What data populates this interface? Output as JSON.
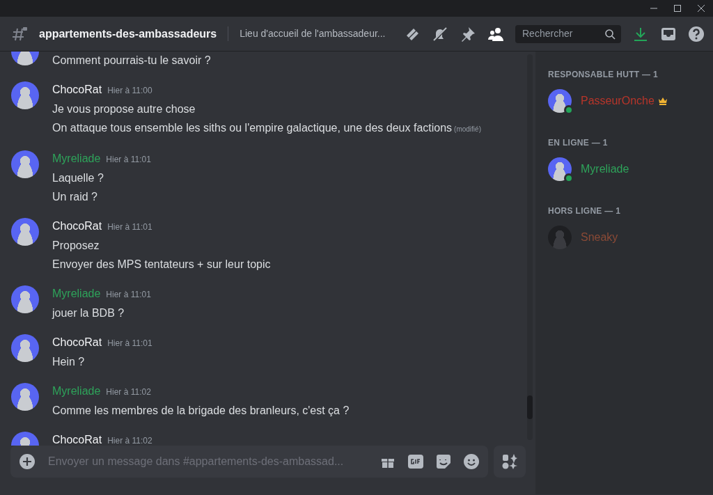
{
  "channel": {
    "name": "appartements-des-ambassadeurs",
    "topic": "Lieu d'accueil de l'ambassadeur..."
  },
  "search": {
    "placeholder": "Rechercher"
  },
  "messages": [
    {
      "lines": [
        {
          "text": "Comment pourrais-tu le savoir ?"
        }
      ]
    },
    {
      "author": "ChocoRat",
      "color": "#f2f3f5",
      "time": "Hier à 11:00",
      "lines": [
        {
          "text": "Je vous propose autre chose"
        },
        {
          "text": "On attaque tous ensemble les siths ou l'empire galactique, une des deux factions",
          "edited": "(modifié)"
        }
      ]
    },
    {
      "author": "Myreliade",
      "color": "#2ea35a",
      "time": "Hier à 11:01",
      "lines": [
        {
          "text": "Laquelle ?"
        },
        {
          "text": "Un raid ?"
        }
      ]
    },
    {
      "author": "ChocoRat",
      "color": "#f2f3f5",
      "time": "Hier à 11:01",
      "lines": [
        {
          "text": "Proposez"
        },
        {
          "text": "Envoyer des MPS tentateurs + sur leur topic"
        }
      ]
    },
    {
      "author": "Myreliade",
      "color": "#2ea35a",
      "time": "Hier à 11:01",
      "lines": [
        {
          "text": "jouer la BDB ?"
        }
      ]
    },
    {
      "author": "ChocoRat",
      "color": "#f2f3f5",
      "time": "Hier à 11:01",
      "lines": [
        {
          "text": "Hein ?"
        }
      ]
    },
    {
      "author": "Myreliade",
      "color": "#2ea35a",
      "time": "Hier à 11:02",
      "lines": [
        {
          "text": "Comme les membres de la brigade des branleurs, c'est ça ?"
        }
      ]
    },
    {
      "author": "ChocoRat",
      "color": "#f2f3f5",
      "time": "Hier à 11:02"
    }
  ],
  "composer": {
    "placeholder": "Envoyer un message dans #appartements-des-ambassad..."
  },
  "member_groups": [
    {
      "title": "RESPONSABLE HUTT — 1",
      "members": [
        {
          "name": "PasseurOnche",
          "color": "#b8352a",
          "online": true,
          "owner": true
        }
      ]
    },
    {
      "title": "EN LIGNE — 1",
      "members": [
        {
          "name": "Myreliade",
          "color": "#2ea35a",
          "online": true,
          "owner": false
        }
      ]
    },
    {
      "title": "HORS LIGNE — 1",
      "members": [
        {
          "name": "Sneaky",
          "color": "#8a4a36",
          "online": false,
          "owner": false
        }
      ]
    }
  ]
}
